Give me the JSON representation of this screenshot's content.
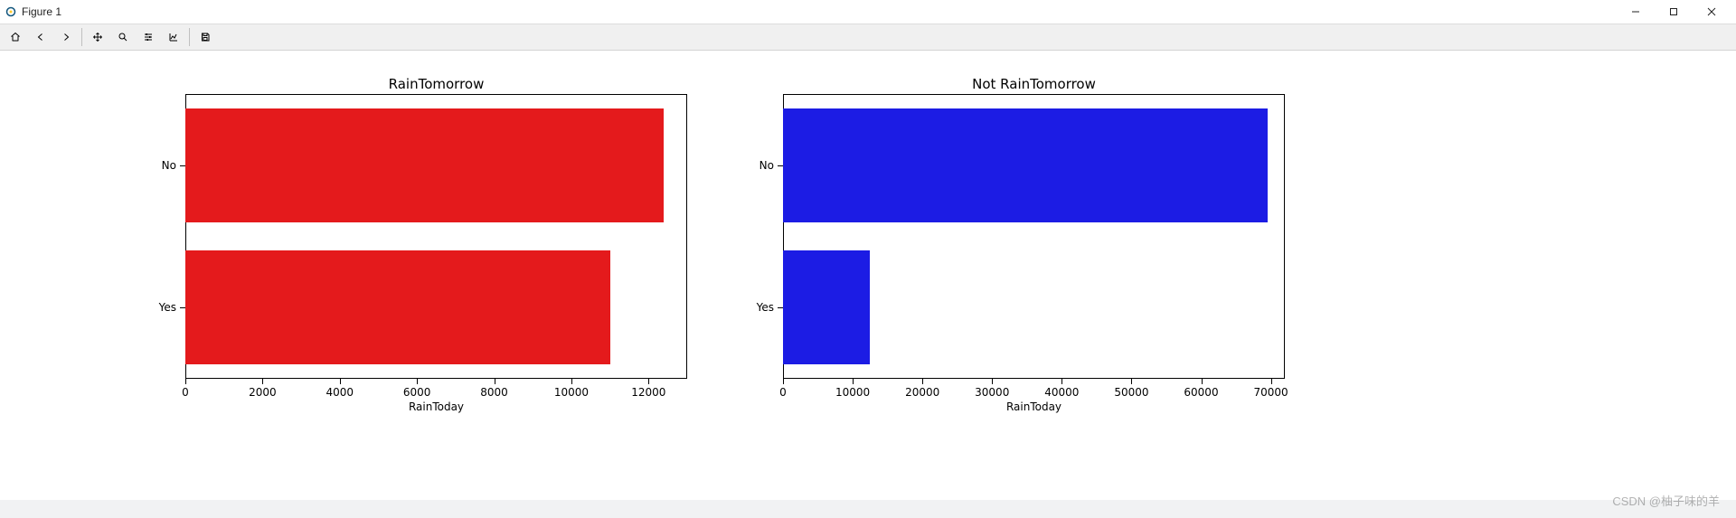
{
  "window": {
    "title": "Figure 1",
    "minimize_btn": "Minimize",
    "maximize_btn": "Maximize",
    "close_btn": "Close"
  },
  "toolbar": {
    "home": "Home",
    "back": "Back",
    "forward": "Forward",
    "pan": "Pan",
    "zoom": "Zoom",
    "subplots": "Configure subplots",
    "axes": "Edit axis",
    "save": "Save"
  },
  "watermark": "CSDN @柚子味的羊",
  "chart_data": [
    {
      "type": "bar",
      "orientation": "horizontal",
      "title": "RainTomorrow",
      "xlabel": "RainToday",
      "ylabel": "",
      "xlim": [
        0,
        13000
      ],
      "xticks": [
        0,
        2000,
        4000,
        6000,
        8000,
        10000,
        12000
      ],
      "categories": [
        "No",
        "Yes"
      ],
      "values": [
        12400,
        11000
      ],
      "color": "#e41a1c"
    },
    {
      "type": "bar",
      "orientation": "horizontal",
      "title": "Not RainTomorrow",
      "xlabel": "RainToday",
      "ylabel": "",
      "xlim": [
        0,
        72000
      ],
      "xticks": [
        0,
        10000,
        20000,
        30000,
        40000,
        50000,
        60000,
        70000
      ],
      "categories": [
        "No",
        "Yes"
      ],
      "values": [
        69500,
        12500
      ],
      "color": "#1c1ce4"
    }
  ],
  "layout": {
    "subplot_left_x": 205,
    "subplot_left_w": 555,
    "subplot_right_x": 866,
    "subplot_right_w": 555,
    "subplot_y": 48,
    "subplot_h": 315
  }
}
